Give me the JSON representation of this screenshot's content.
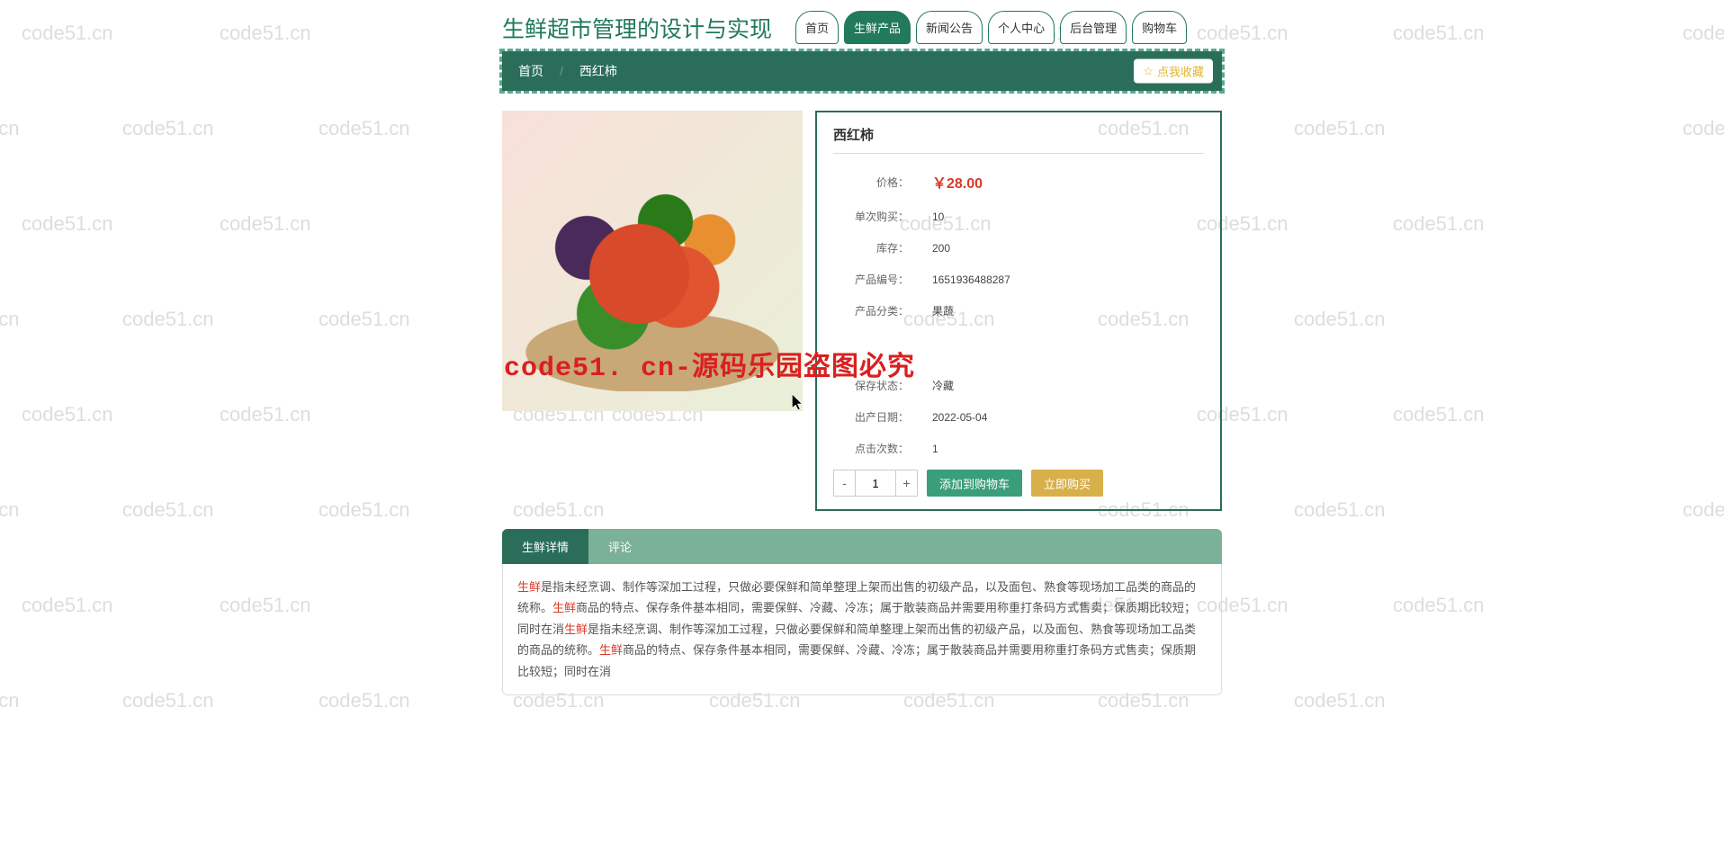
{
  "watermark": "code51.cn",
  "overlay_text": "code51. cn-源码乐园盗图必究",
  "header": {
    "logo": "生鲜超市管理的设计与实现",
    "nav": [
      "首页",
      "生鲜产品",
      "新闻公告",
      "个人中心",
      "后台管理",
      "购物车"
    ]
  },
  "breadcrumb": {
    "home": "首页",
    "current": "西红柿"
  },
  "fav_label": "点我收藏",
  "product": {
    "title": "西红柿",
    "price_label": "价格：",
    "price": "￥28.00",
    "single_buy_label": "单次购买：",
    "single_buy": "10",
    "stock_label": "库存：",
    "stock": "200",
    "sku_label": "产品编号：",
    "sku": "1651936488287",
    "category_label": "产品分类：",
    "category": "果蔬",
    "storage_label": "保存状态：",
    "storage": "冷藏",
    "prod_date_label": "出产日期：",
    "prod_date": "2022-05-04",
    "clicks_label": "点击次数：",
    "clicks": "1",
    "qty_value": "1",
    "cart_btn": "添加到购物车",
    "buy_btn": "立即购买"
  },
  "detail_tabs": [
    "生鲜详情",
    "评论"
  ],
  "detail": {
    "kw": "生鲜",
    "s1": "是指未经烹调、制作等深加工过程，只做必要保鲜和简单整理上架而出售的初级产品，以及面包、熟食等现场加工品类的商品的统称。",
    "s2": "商品的特点、保存条件基本相同，需要保鲜、冷藏、冷冻；属于散装商品并需要用称重打条码方式售卖；保质期比较短；同时在消",
    "s3": "是指未经烹调、制作等深加工过程，只做必要保鲜和简单整理上架而出售的初级产品，以及面包、熟食等现场加工品类的商品的统称。",
    "s4": "商品的特点、保存条件基本相同，需要保鲜、冷藏、冷冻；属于散装商品并需要用称重打条码方式售卖；保质期比较短；同时在消"
  }
}
